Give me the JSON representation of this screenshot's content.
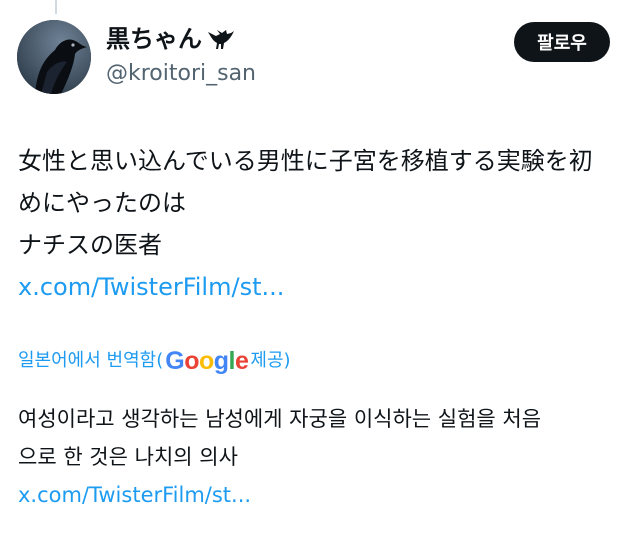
{
  "user": {
    "display_name": "黒ちゃん",
    "handle": "@kroitori_san",
    "badge_icon": "crow-icon"
  },
  "follow_label": "팔로우",
  "tweet": {
    "lines": [
      "女性と思い込んでいる男性に子宮を移植する実験を初",
      "めにやったのは",
      "ナチスの医者"
    ],
    "link": "x.com/TwisterFilm/st..."
  },
  "translation": {
    "prefix": "일본어에서 번역함(",
    "google": [
      "G",
      "o",
      "o",
      "g",
      "l",
      "e"
    ],
    "suffix": " 제공)",
    "lines": [
      "여성이라고 생각하는 남성에게 자궁을 이식하는 실험을 처음",
      "으로 한 것은 나치의 의사"
    ],
    "link": "x.com/TwisterFilm/st..."
  },
  "colors": {
    "link": "#1d9bf0",
    "text": "#0f1419",
    "secondary": "#536471",
    "button": "#0f1419"
  }
}
